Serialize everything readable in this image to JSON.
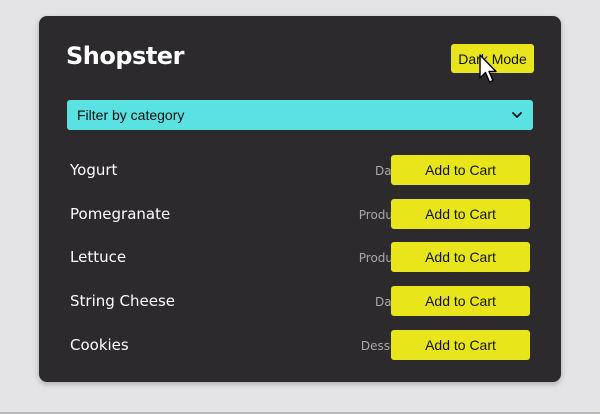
{
  "app": {
    "title": "Shopster",
    "mode_button_label": "Dark Mode",
    "accent_color": "#e8e61a",
    "filter_color": "#5ae2e2",
    "card_color": "#2c2a2d"
  },
  "filter": {
    "selected": "Filter by category"
  },
  "products": [
    {
      "name": "Yogurt",
      "category": "Dairy",
      "button": "Add to Cart"
    },
    {
      "name": "Pomegranate",
      "category": "Produce",
      "button": "Add to Cart"
    },
    {
      "name": "Lettuce",
      "category": "Produce",
      "button": "Add to Cart"
    },
    {
      "name": "String Cheese",
      "category": "Dairy",
      "button": "Add to Cart"
    },
    {
      "name": "Cookies",
      "category": "Dessert",
      "button": "Add to Cart"
    }
  ]
}
